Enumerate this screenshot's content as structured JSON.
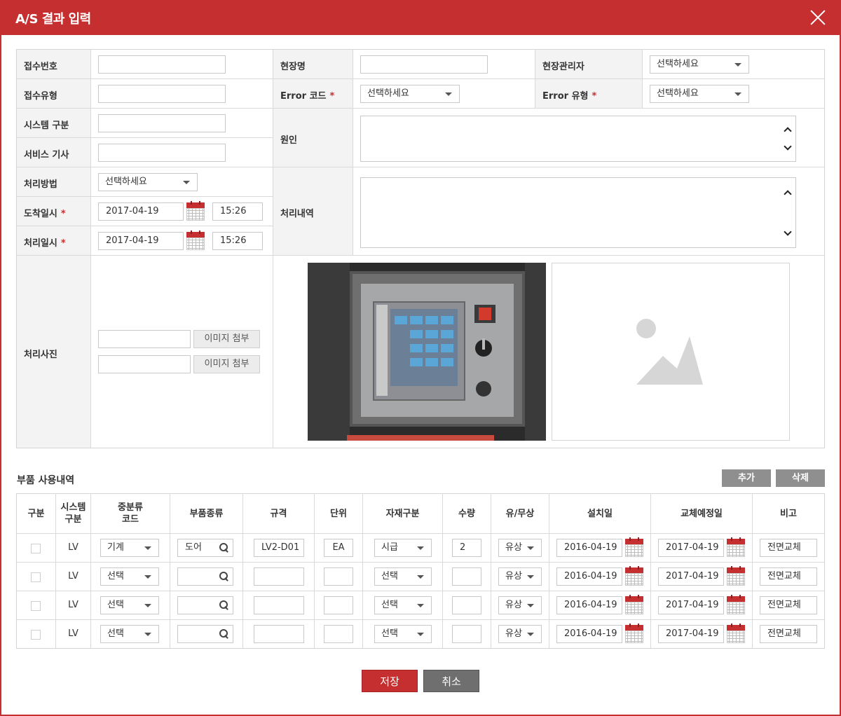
{
  "window": {
    "title": "A/S 결과 입력"
  },
  "form": {
    "receipt_no": {
      "label": "접수번호",
      "value": ""
    },
    "site_name": {
      "label": "현장명",
      "value": ""
    },
    "site_manager": {
      "label": "현장관리자",
      "value": "선택하세요"
    },
    "receipt_type": {
      "label": "접수유형",
      "value": ""
    },
    "error_code": {
      "label": "Error 코드",
      "required": "*",
      "value": "선택하세요"
    },
    "error_type": {
      "label": "Error 유형",
      "required": "*",
      "value": "선택하세요"
    },
    "system_type": {
      "label": "시스템 구분",
      "value": ""
    },
    "cause": {
      "label": "원인",
      "value": ""
    },
    "service_tech": {
      "label": "서비스 기사",
      "value": ""
    },
    "method": {
      "label": "처리방법",
      "value": "선택하세요"
    },
    "arrival": {
      "label": "도착일시",
      "required": "*",
      "date": "2017-04-19",
      "time": "15:26"
    },
    "process_date": {
      "label": "처리일시",
      "required": "*",
      "date": "2017-04-19",
      "time": "15:26"
    },
    "process_detail": {
      "label": "처리내역",
      "value": ""
    },
    "photo": {
      "label": "처리사진",
      "attach_label": "이미지 첨부",
      "file1": "",
      "file2": ""
    }
  },
  "parts": {
    "title": "부품 사용내역",
    "add_label": "추가",
    "delete_label": "삭제",
    "headers": [
      "구분",
      "시스템\n구분",
      "중분류\n코드",
      "부품종류",
      "규격",
      "단위",
      "자재구분",
      "수량",
      "유/무상",
      "설치일",
      "교체예정일",
      "비고"
    ],
    "rows": [
      {
        "sys": "LV",
        "code": "기계",
        "part": "도어",
        "spec": "LV2-D01",
        "unit": "EA",
        "mat": "시급",
        "qty": "2",
        "paid": "유상",
        "install": "2016-04-19",
        "replace": "2017-04-19",
        "note": "전면교체"
      },
      {
        "sys": "LV",
        "code": "선택",
        "part": "",
        "spec": "",
        "unit": "",
        "mat": "선택",
        "qty": "",
        "paid": "유상",
        "install": "2016-04-19",
        "replace": "2017-04-19",
        "note": "전면교체"
      },
      {
        "sys": "LV",
        "code": "선택",
        "part": "",
        "spec": "",
        "unit": "",
        "mat": "선택",
        "qty": "",
        "paid": "유상",
        "install": "2016-04-19",
        "replace": "2017-04-19",
        "note": "전면교체"
      },
      {
        "sys": "LV",
        "code": "선택",
        "part": "",
        "spec": "",
        "unit": "",
        "mat": "선택",
        "qty": "",
        "paid": "유상",
        "install": "2016-04-19",
        "replace": "2017-04-19",
        "note": "전면교체"
      }
    ]
  },
  "actions": {
    "save_label": "저장",
    "cancel_label": "취소"
  },
  "colors": {
    "accent": "#c62f2f",
    "label_bg": "#f3f3f3",
    "border": "#d9d9d9"
  }
}
